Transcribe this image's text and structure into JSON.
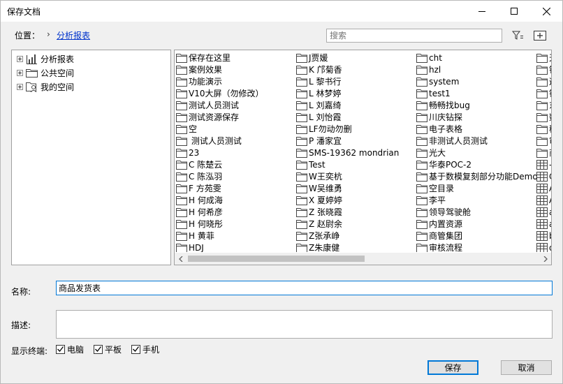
{
  "window": {
    "title": "保存文档"
  },
  "location": {
    "label": "位置：",
    "separator": "›",
    "current": "分析报表"
  },
  "search": {
    "placeholder": "搜索",
    "value": ""
  },
  "tree": {
    "items": [
      {
        "label": "分析报表",
        "icon": "bar-chart-icon"
      },
      {
        "label": "公共空间",
        "icon": "folder-icon"
      },
      {
        "label": "我的空间",
        "icon": "user-folder-icon"
      }
    ]
  },
  "files": {
    "columns": [
      [
        "保存在这里",
        "案例效果",
        "功能演示",
        "V10大屏（勿修改）",
        "测试人员测试",
        "测试资源保存",
        "空",
        " 测试人员测试",
        "23",
        "C 陈楚云",
        "C 陈泓羽",
        "F 方苑雯",
        "H 何成海",
        "H 何希彦",
        "H 何晓彤",
        "H 黄菲",
        "HDJ"
      ],
      [
        "J贾媛",
        "K 邝菊香",
        "L 黎书行",
        "L 林梦婷",
        "L 刘嘉绮",
        "L 刘怡霞",
        "LF勿动勿删",
        "P 潘家宜",
        "SMS-19362 mondrian",
        "Test",
        "W王奕杭",
        "W吴维勇",
        "X 夏婷婷",
        "Z 张晓霞",
        "Z 赵尉余",
        "Z张承峥",
        "Z朱康健"
      ],
      [
        "cht",
        "hzl",
        "system",
        "test1",
        "畅畅找bug",
        "川庆钻探",
        "电子表格",
        "非测试人员测试",
        "光大",
        "华泰POC-2",
        "基于数模复刻部分功能Demo",
        "空目录",
        "李平",
        "领导驾驶舱",
        "内置资源",
        "商管集团",
        "审核流程"
      ],
      [
        "天",
        "钢",
        "这",
        "钢",
        "东",
        "数",
        "移",
        "审",
        "商",
        "-",
        "C",
        "A",
        "A",
        "a",
        "a",
        "b",
        "o"
      ]
    ],
    "col4_types": [
      "folder",
      "folder",
      "folder",
      "folder",
      "folder",
      "folder",
      "folder",
      "folder",
      "folder",
      "table",
      "table",
      "table",
      "table",
      "table",
      "table",
      "table",
      "table"
    ]
  },
  "form": {
    "name_label": "名称:",
    "name_value": "商品发货表",
    "desc_label": "描述:",
    "desc_value": "",
    "terminals_label": "显示终端:",
    "terminals": [
      {
        "label": "电脑",
        "checked": true
      },
      {
        "label": "平板",
        "checked": true
      },
      {
        "label": "手机",
        "checked": true
      }
    ]
  },
  "buttons": {
    "save": "保存",
    "cancel": "取消"
  }
}
